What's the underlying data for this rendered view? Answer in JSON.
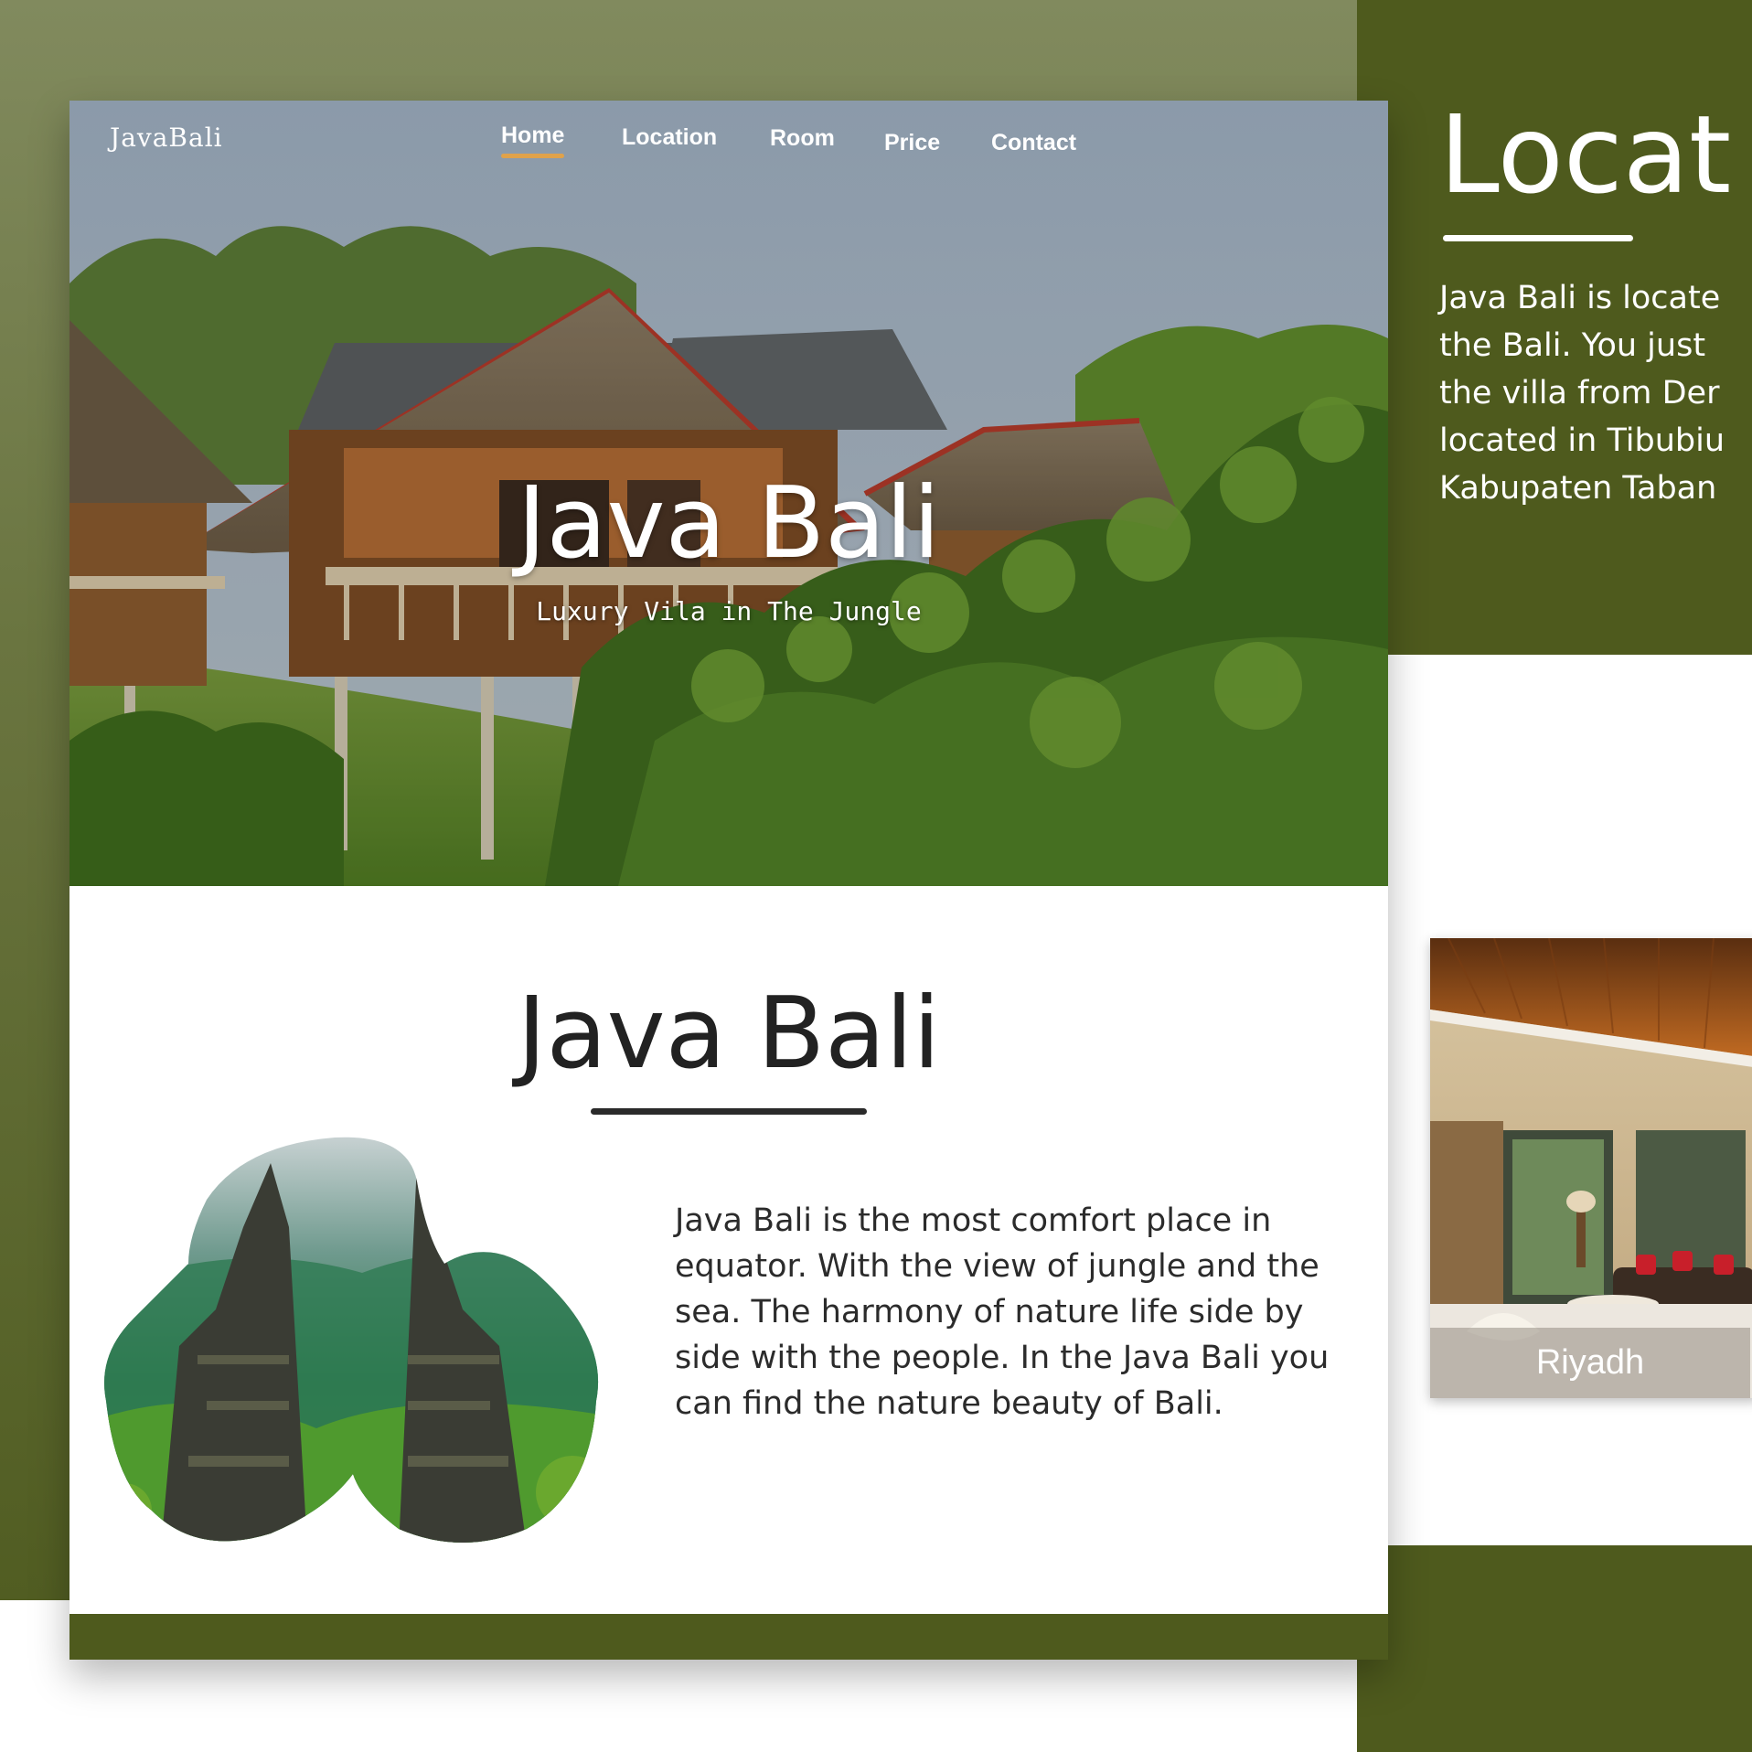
{
  "brand": {
    "logo": "JavaBali"
  },
  "nav": {
    "items": [
      {
        "label": "Home",
        "active": true
      },
      {
        "label": "Location",
        "active": false
      },
      {
        "label": "Room",
        "active": false
      },
      {
        "label": "Price",
        "active": false
      },
      {
        "label": "Contact",
        "active": false
      }
    ]
  },
  "hero": {
    "title": "Java Bali",
    "subtitle": "Luxury Vila in The Jungle"
  },
  "about": {
    "title": "Java Bali",
    "body": "Java Bali is the most comfort place in equator. With the view of jungle and the sea. The harmony of nature life side by side with the people. In the Java Bali you can find the nature beauty of Bali."
  },
  "location": {
    "title": "Locat",
    "lines": [
      "Java Bali is locate",
      "the Bali. You just",
      "the villa from Der",
      "located in Tibubiu",
      "Kabupaten Taban"
    ]
  },
  "room": {
    "label": "Riyadh"
  },
  "colors": {
    "olive_dark": "#4e5a1d",
    "olive_light": "#818a5e",
    "accent_underline": "#e0a24a",
    "text_dark": "#2b2b2b"
  }
}
